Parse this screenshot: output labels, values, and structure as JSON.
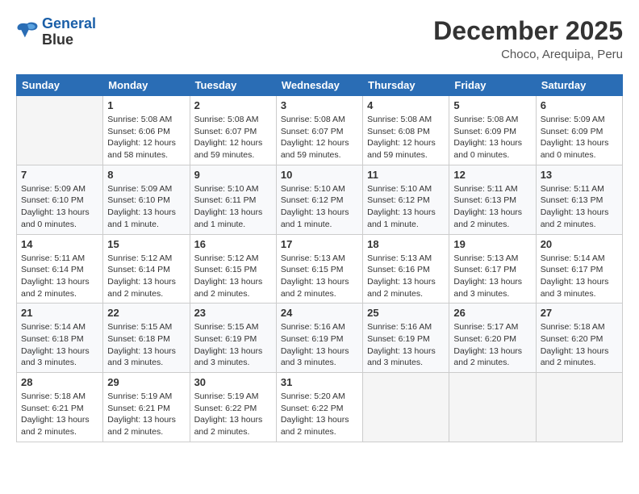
{
  "header": {
    "logo_line1": "General",
    "logo_line2": "Blue",
    "month": "December 2025",
    "location": "Choco, Arequipa, Peru"
  },
  "weekdays": [
    "Sunday",
    "Monday",
    "Tuesday",
    "Wednesday",
    "Thursday",
    "Friday",
    "Saturday"
  ],
  "weeks": [
    [
      {
        "day": "",
        "empty": true
      },
      {
        "day": "1",
        "sunrise": "Sunrise: 5:08 AM",
        "sunset": "Sunset: 6:06 PM",
        "daylight": "Daylight: 12 hours and 58 minutes."
      },
      {
        "day": "2",
        "sunrise": "Sunrise: 5:08 AM",
        "sunset": "Sunset: 6:07 PM",
        "daylight": "Daylight: 12 hours and 59 minutes."
      },
      {
        "day": "3",
        "sunrise": "Sunrise: 5:08 AM",
        "sunset": "Sunset: 6:07 PM",
        "daylight": "Daylight: 12 hours and 59 minutes."
      },
      {
        "day": "4",
        "sunrise": "Sunrise: 5:08 AM",
        "sunset": "Sunset: 6:08 PM",
        "daylight": "Daylight: 12 hours and 59 minutes."
      },
      {
        "day": "5",
        "sunrise": "Sunrise: 5:08 AM",
        "sunset": "Sunset: 6:09 PM",
        "daylight": "Daylight: 13 hours and 0 minutes."
      },
      {
        "day": "6",
        "sunrise": "Sunrise: 5:09 AM",
        "sunset": "Sunset: 6:09 PM",
        "daylight": "Daylight: 13 hours and 0 minutes."
      }
    ],
    [
      {
        "day": "7",
        "sunrise": "Sunrise: 5:09 AM",
        "sunset": "Sunset: 6:10 PM",
        "daylight": "Daylight: 13 hours and 0 minutes."
      },
      {
        "day": "8",
        "sunrise": "Sunrise: 5:09 AM",
        "sunset": "Sunset: 6:10 PM",
        "daylight": "Daylight: 13 hours and 1 minute."
      },
      {
        "day": "9",
        "sunrise": "Sunrise: 5:10 AM",
        "sunset": "Sunset: 6:11 PM",
        "daylight": "Daylight: 13 hours and 1 minute."
      },
      {
        "day": "10",
        "sunrise": "Sunrise: 5:10 AM",
        "sunset": "Sunset: 6:12 PM",
        "daylight": "Daylight: 13 hours and 1 minute."
      },
      {
        "day": "11",
        "sunrise": "Sunrise: 5:10 AM",
        "sunset": "Sunset: 6:12 PM",
        "daylight": "Daylight: 13 hours and 1 minute."
      },
      {
        "day": "12",
        "sunrise": "Sunrise: 5:11 AM",
        "sunset": "Sunset: 6:13 PM",
        "daylight": "Daylight: 13 hours and 2 minutes."
      },
      {
        "day": "13",
        "sunrise": "Sunrise: 5:11 AM",
        "sunset": "Sunset: 6:13 PM",
        "daylight": "Daylight: 13 hours and 2 minutes."
      }
    ],
    [
      {
        "day": "14",
        "sunrise": "Sunrise: 5:11 AM",
        "sunset": "Sunset: 6:14 PM",
        "daylight": "Daylight: 13 hours and 2 minutes."
      },
      {
        "day": "15",
        "sunrise": "Sunrise: 5:12 AM",
        "sunset": "Sunset: 6:14 PM",
        "daylight": "Daylight: 13 hours and 2 minutes."
      },
      {
        "day": "16",
        "sunrise": "Sunrise: 5:12 AM",
        "sunset": "Sunset: 6:15 PM",
        "daylight": "Daylight: 13 hours and 2 minutes."
      },
      {
        "day": "17",
        "sunrise": "Sunrise: 5:13 AM",
        "sunset": "Sunset: 6:15 PM",
        "daylight": "Daylight: 13 hours and 2 minutes."
      },
      {
        "day": "18",
        "sunrise": "Sunrise: 5:13 AM",
        "sunset": "Sunset: 6:16 PM",
        "daylight": "Daylight: 13 hours and 2 minutes."
      },
      {
        "day": "19",
        "sunrise": "Sunrise: 5:13 AM",
        "sunset": "Sunset: 6:17 PM",
        "daylight": "Daylight: 13 hours and 3 minutes."
      },
      {
        "day": "20",
        "sunrise": "Sunrise: 5:14 AM",
        "sunset": "Sunset: 6:17 PM",
        "daylight": "Daylight: 13 hours and 3 minutes."
      }
    ],
    [
      {
        "day": "21",
        "sunrise": "Sunrise: 5:14 AM",
        "sunset": "Sunset: 6:18 PM",
        "daylight": "Daylight: 13 hours and 3 minutes."
      },
      {
        "day": "22",
        "sunrise": "Sunrise: 5:15 AM",
        "sunset": "Sunset: 6:18 PM",
        "daylight": "Daylight: 13 hours and 3 minutes."
      },
      {
        "day": "23",
        "sunrise": "Sunrise: 5:15 AM",
        "sunset": "Sunset: 6:19 PM",
        "daylight": "Daylight: 13 hours and 3 minutes."
      },
      {
        "day": "24",
        "sunrise": "Sunrise: 5:16 AM",
        "sunset": "Sunset: 6:19 PM",
        "daylight": "Daylight: 13 hours and 3 minutes."
      },
      {
        "day": "25",
        "sunrise": "Sunrise: 5:16 AM",
        "sunset": "Sunset: 6:19 PM",
        "daylight": "Daylight: 13 hours and 3 minutes."
      },
      {
        "day": "26",
        "sunrise": "Sunrise: 5:17 AM",
        "sunset": "Sunset: 6:20 PM",
        "daylight": "Daylight: 13 hours and 2 minutes."
      },
      {
        "day": "27",
        "sunrise": "Sunrise: 5:18 AM",
        "sunset": "Sunset: 6:20 PM",
        "daylight": "Daylight: 13 hours and 2 minutes."
      }
    ],
    [
      {
        "day": "28",
        "sunrise": "Sunrise: 5:18 AM",
        "sunset": "Sunset: 6:21 PM",
        "daylight": "Daylight: 13 hours and 2 minutes."
      },
      {
        "day": "29",
        "sunrise": "Sunrise: 5:19 AM",
        "sunset": "Sunset: 6:21 PM",
        "daylight": "Daylight: 13 hours and 2 minutes."
      },
      {
        "day": "30",
        "sunrise": "Sunrise: 5:19 AM",
        "sunset": "Sunset: 6:22 PM",
        "daylight": "Daylight: 13 hours and 2 minutes."
      },
      {
        "day": "31",
        "sunrise": "Sunrise: 5:20 AM",
        "sunset": "Sunset: 6:22 PM",
        "daylight": "Daylight: 13 hours and 2 minutes."
      },
      {
        "day": "",
        "empty": true
      },
      {
        "day": "",
        "empty": true
      },
      {
        "day": "",
        "empty": true
      }
    ]
  ]
}
